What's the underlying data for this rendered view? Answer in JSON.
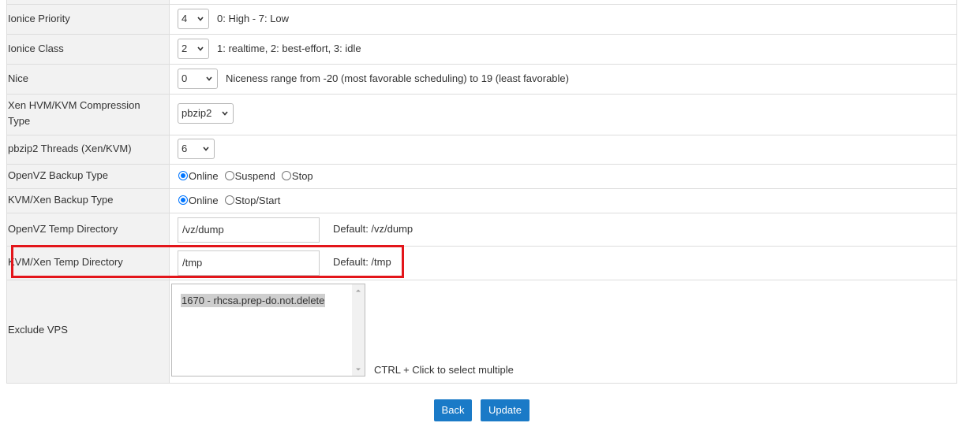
{
  "rows": {
    "ionice_priority": {
      "label": "Ionice Priority",
      "value": "4",
      "hint": "0: High - 7: Low"
    },
    "ionice_class": {
      "label": "Ionice Class",
      "value": "2",
      "hint": "1: realtime, 2: best-effort, 3: idle"
    },
    "nice": {
      "label": "Nice",
      "value": "0",
      "hint": "Niceness range from -20 (most favorable scheduling) to 19 (least favorable)"
    },
    "compression": {
      "label": "Xen HVM/KVM Compression Type",
      "value": "pbzip2"
    },
    "pbzip2_threads": {
      "label": "pbzip2 Threads (Xen/KVM)",
      "value": "6"
    },
    "openvz_backup_type": {
      "label": "OpenVZ Backup Type",
      "options": [
        "Online",
        "Suspend",
        "Stop"
      ],
      "selected": "Online"
    },
    "kvm_backup_type": {
      "label": "KVM/Xen Backup Type",
      "options": [
        "Online",
        "Stop/Start"
      ],
      "selected": "Online"
    },
    "openvz_temp_dir": {
      "label": "OpenVZ Temp Directory",
      "value": "/vz/dump",
      "hint": "Default: /vz/dump"
    },
    "kvm_temp_dir": {
      "label": "KVM/Xen Temp Directory",
      "value": "/tmp",
      "hint": "Default: /tmp"
    },
    "exclude_vps": {
      "label": "Exclude VPS",
      "options": [
        "1670 - rhcsa.prep-do.not.delete"
      ],
      "hint": "CTRL + Click to select multiple"
    }
  },
  "buttons": {
    "back": "Back",
    "update": "Update"
  },
  "colors": {
    "highlight": "#e3151a",
    "button": "#1a7ac7",
    "radio_checked": "#0075ff"
  }
}
